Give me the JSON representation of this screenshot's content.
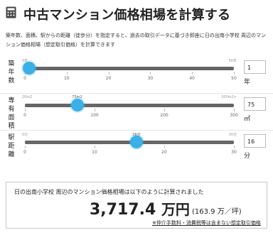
{
  "header": {
    "title": "中古マンション価格相場を計算する"
  },
  "description": "築年数、面積、駅からの距離（徒歩分）を指定すると、過去の取引データに基づき即座に日の出南小学校 周辺のマンション価格相場（想定取引価格）を計算できます",
  "sliders": [
    {
      "label": "築年数",
      "min_label": "0年",
      "max_label": "50年",
      "ticks": [
        "0",
        "10",
        "20",
        "30",
        "40",
        "50"
      ],
      "min": 0,
      "max": 50,
      "value": 1,
      "thumb_label": "",
      "input_value": "1",
      "unit": "年"
    },
    {
      "label": "専有面積",
      "min_label": "20m2",
      "max_label": "300m2+",
      "ticks": [
        "0",
        "100",
        "200",
        "300"
      ],
      "min": 0,
      "max": 300,
      "value": 75,
      "thumb_label": "75m2",
      "input_value": "75",
      "unit": "㎡"
    },
    {
      "label": "駅距離",
      "min_label": "0分",
      "max_label": "30分",
      "ticks": [
        "0",
        "10",
        "20",
        "30"
      ],
      "min": 0,
      "max": 30,
      "value": 16,
      "thumb_label": "16分",
      "input_value": "16",
      "unit": "分"
    }
  ],
  "result": {
    "lead": "日の出南小学校 周辺のマンション価格相場は以下のように計算されました",
    "amount": "3,717.4",
    "amount_unit": "万円",
    "per_tsubo": "(163.9 万／坪)",
    "note": "※仲介手数料・消費税等は含まない想定取引価格"
  },
  "colors": {
    "thumb": "#3ab0e6",
    "track": "#666666"
  }
}
